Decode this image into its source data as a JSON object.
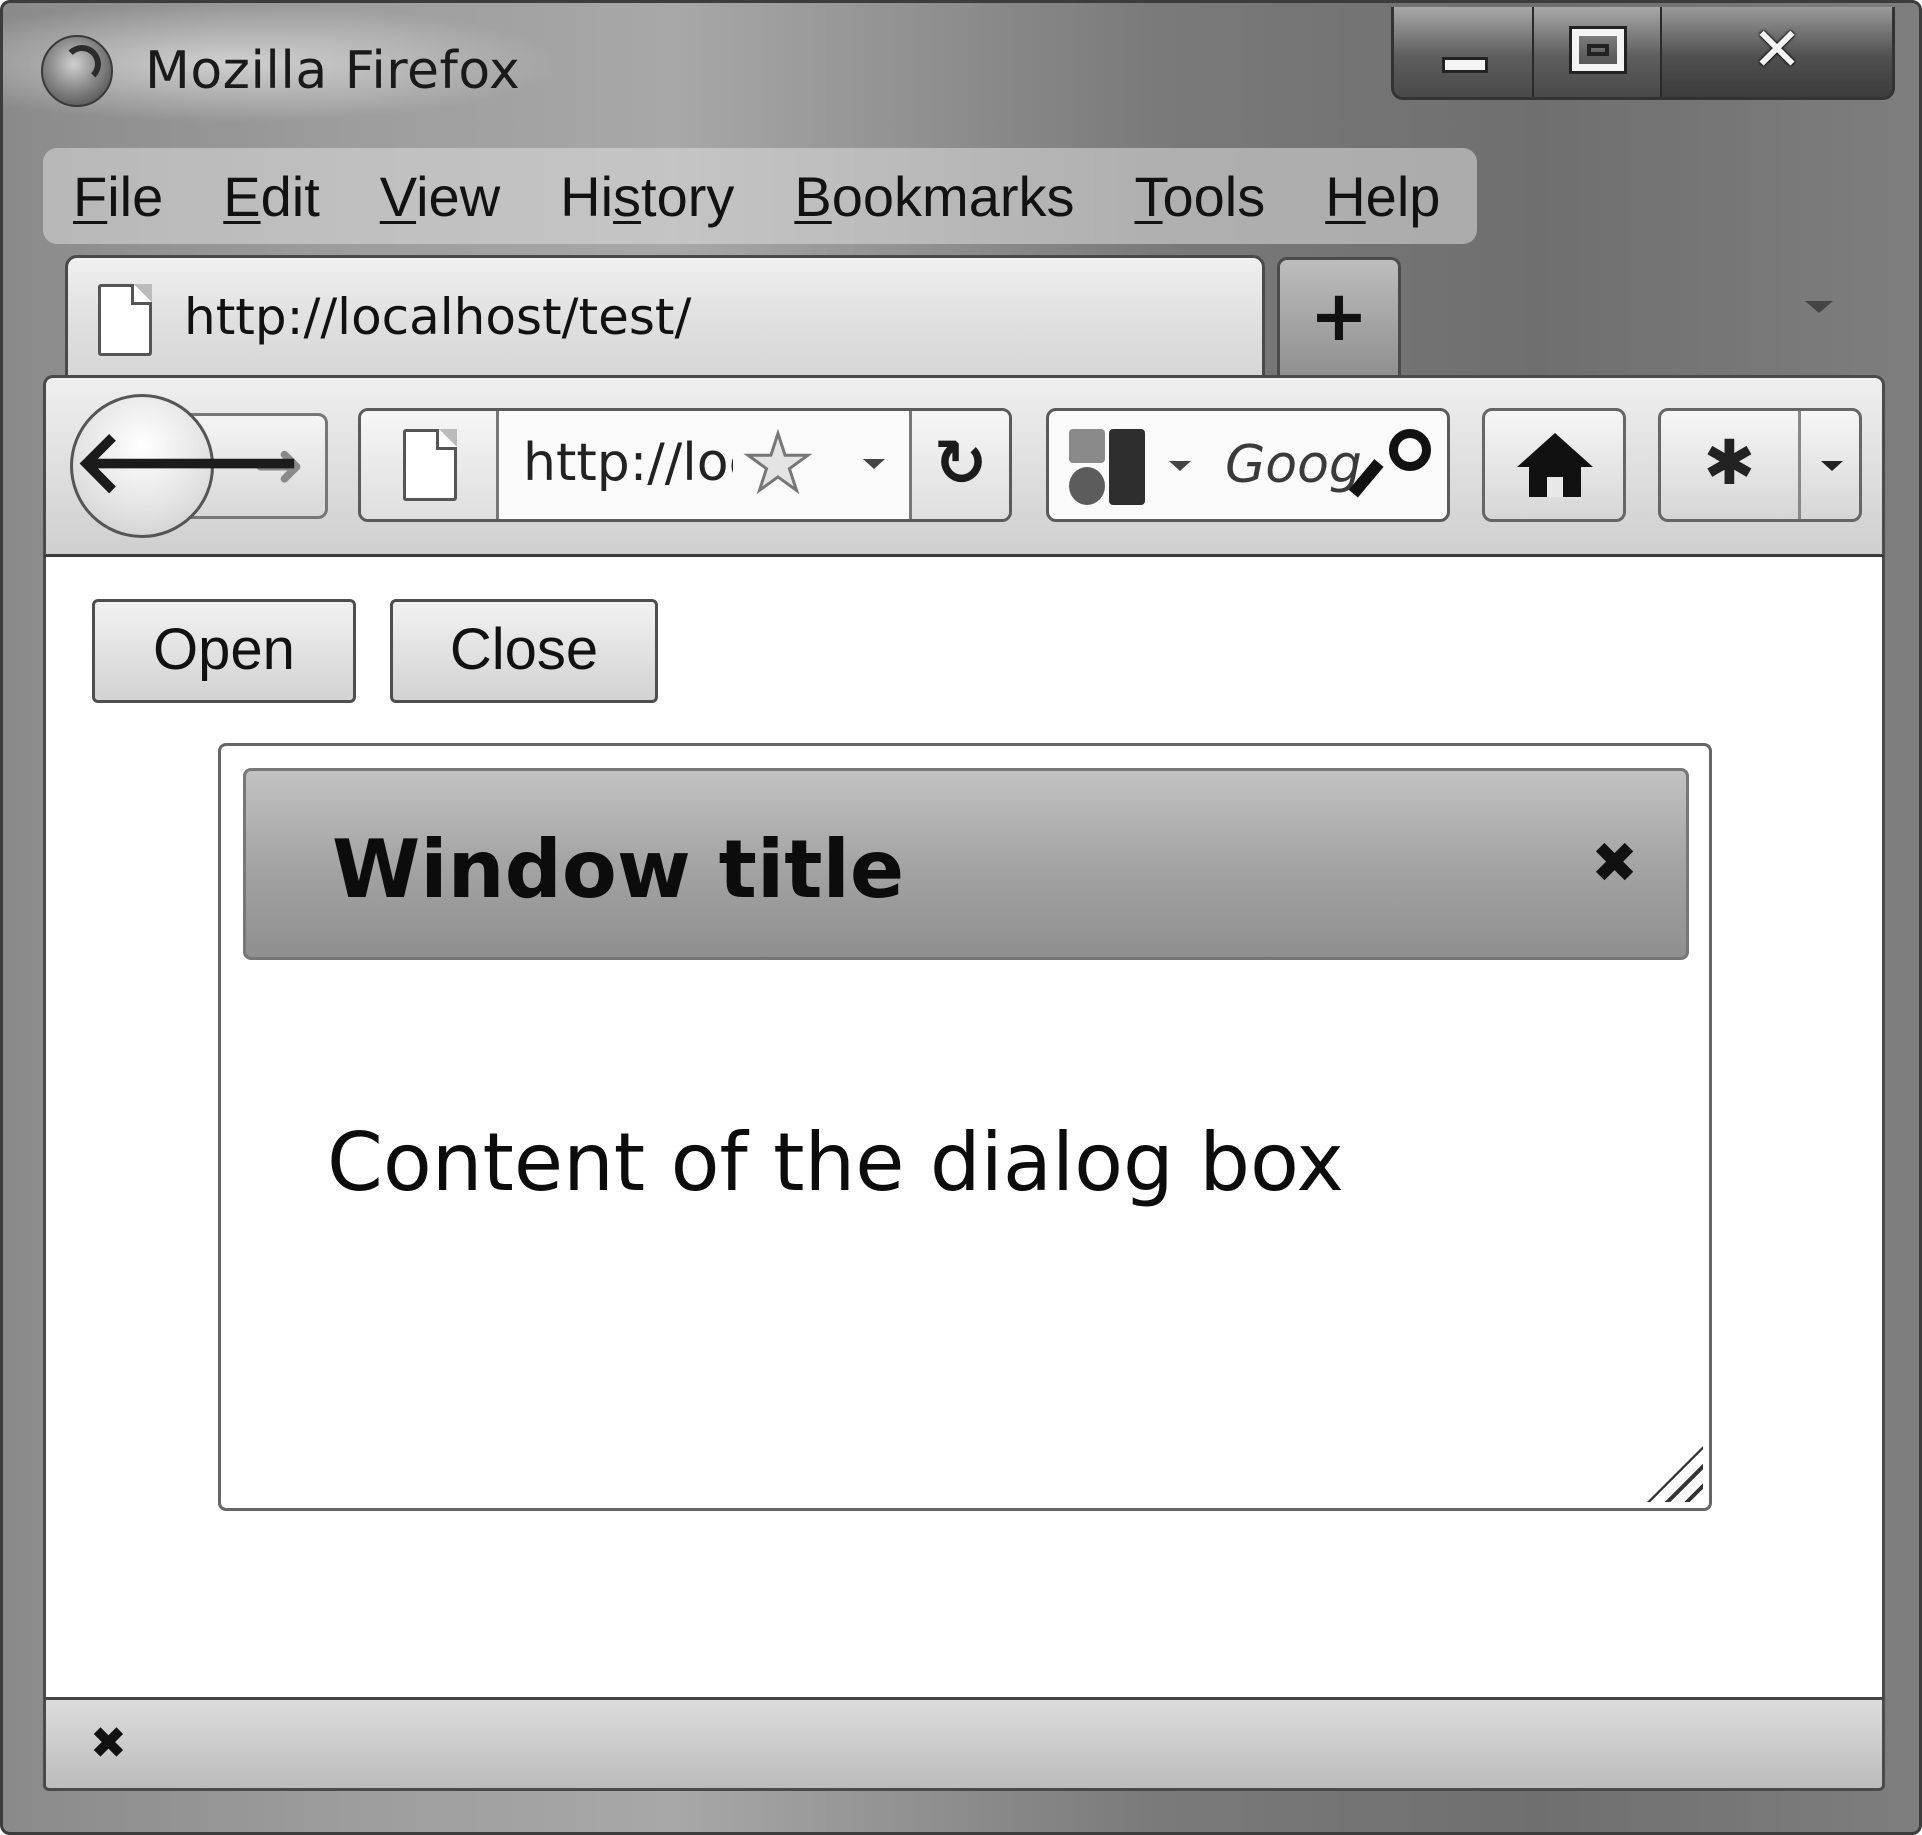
{
  "window": {
    "title": "Mozilla Firefox",
    "controls": {
      "minimize": "minimize",
      "maximize": "maximize",
      "close": "✕"
    }
  },
  "menubar": {
    "items": [
      {
        "label": "File",
        "accel": "F",
        "rest": "ile"
      },
      {
        "label": "Edit",
        "accel": "E",
        "rest": "dit"
      },
      {
        "label": "View",
        "accel": "V",
        "rest": "iew"
      },
      {
        "label": "History",
        "pre": "Hi",
        "accel": "s",
        "rest": "tory"
      },
      {
        "label": "Bookmarks",
        "accel": "B",
        "rest": "ookmarks"
      },
      {
        "label": "Tools",
        "accel": "T",
        "rest": "ools"
      },
      {
        "label": "Help",
        "accel": "H",
        "rest": "elp"
      }
    ]
  },
  "tabs": {
    "active_title": "http://localhost/test/",
    "new_tab_label": "+"
  },
  "navbar": {
    "back_glyph": "🡐",
    "forward_glyph": "➜",
    "url_text": "http://localhost/test/",
    "reload_glyph": "↻",
    "search_text": "Google",
    "extension_glyph": "✱"
  },
  "page": {
    "open_button": "Open",
    "close_button": "Close"
  },
  "dialog": {
    "title": "Window title",
    "close_glyph": "✖",
    "content": "Content of the dialog box"
  },
  "statusbar": {
    "close_glyph": "✖"
  },
  "colors": {
    "frame": "#8a8a8a",
    "dialog_header": "#a4a4a4",
    "content_bg": "#ffffff"
  }
}
